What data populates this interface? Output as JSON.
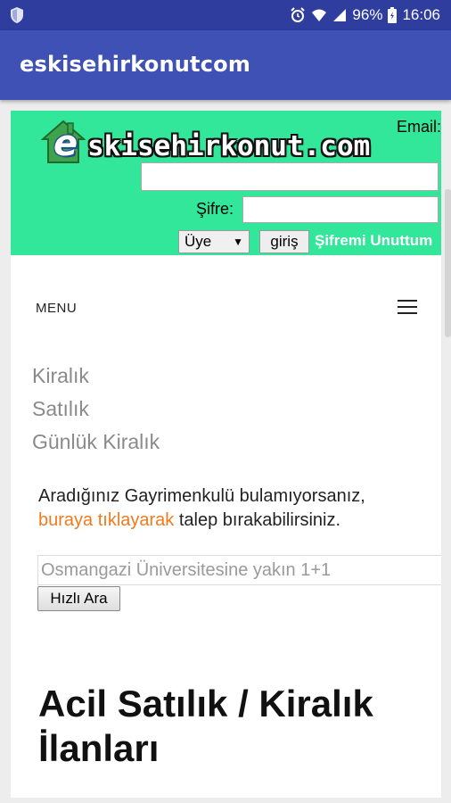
{
  "status_bar": {
    "battery": "96%",
    "time": "16:06"
  },
  "app_bar": {
    "title": "eskisehirkonutcom"
  },
  "header": {
    "logo_e": "e",
    "logo_text": "skisehirkonut.com",
    "email_label": "Email:",
    "email_value": "",
    "password_label": "Şifre:",
    "password_value": "",
    "role_select": "Üye",
    "login_button": "giriş",
    "forgot_password": "Şifremi Unuttum"
  },
  "menu": {
    "label": "MENU",
    "items": [
      "Kiralık",
      "Satılık",
      "Günlük Kiralık"
    ]
  },
  "info": {
    "line1": "Aradığınız Gayrimenkulü bulamıyorsanız,",
    "link": "buraya tıklayarak",
    "line2_rest": " talep bırakabilirsiniz."
  },
  "search": {
    "placeholder": "Osmangazi Üniversitesine yakın 1+1",
    "button": "Hızlı Ara"
  },
  "section_title": "Acil Satılık / Kiralık İlanları",
  "colors": {
    "status_bar": "#2e3d9e",
    "app_bar": "#3f51b5",
    "header_green": "#32e69a",
    "link_orange": "#f07a1e"
  }
}
